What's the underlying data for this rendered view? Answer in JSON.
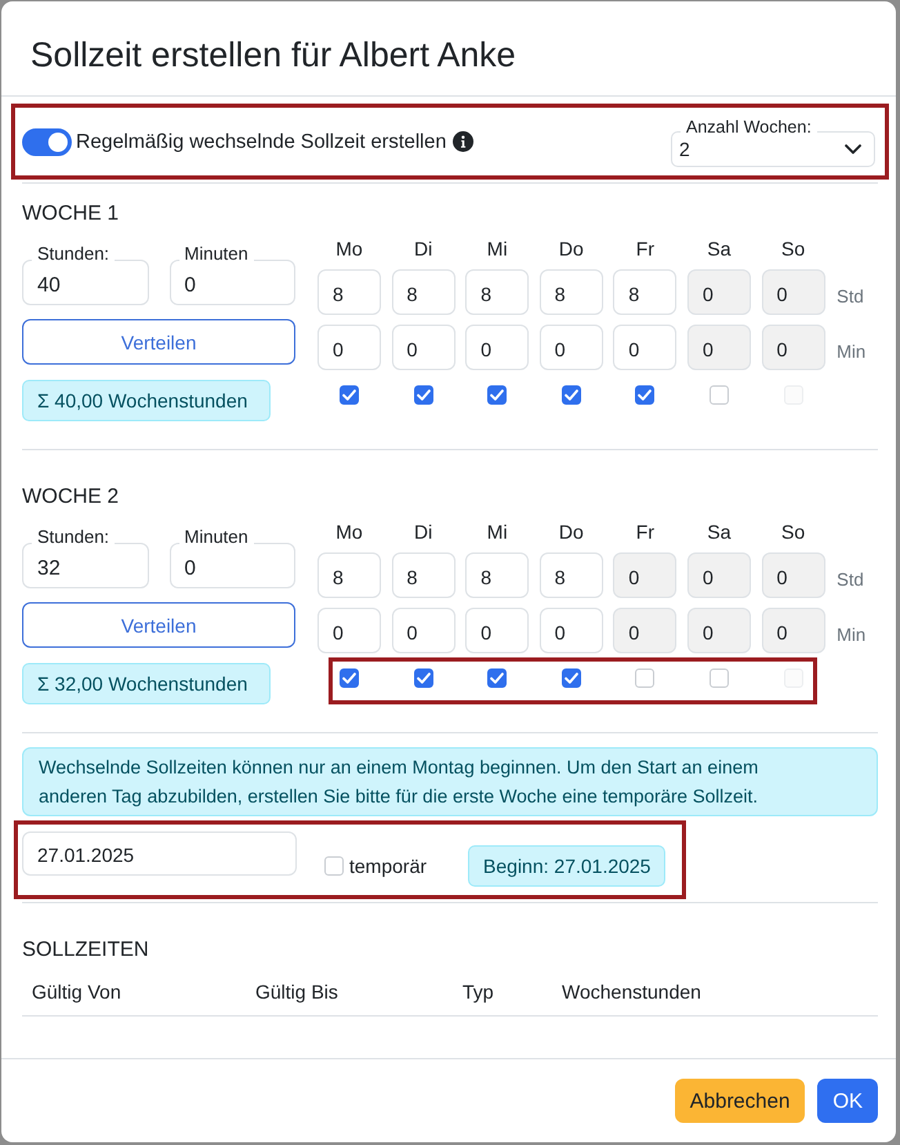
{
  "dialog": {
    "title": "Sollzeit erstellen für Albert Anke"
  },
  "options": {
    "highlighted": true,
    "toggle": {
      "label": "Regelmäßig wechselnde Sollzeit erstellen",
      "on": true
    },
    "weeks_count": {
      "label": "Anzahl Wochen:",
      "value": "2"
    }
  },
  "weeks": [
    {
      "title": "WOCHE 1",
      "hours": {
        "label": "Stunden:",
        "value": "40"
      },
      "minutes": {
        "label": "Minuten",
        "value": "0"
      },
      "distribute_button": "Verteilen",
      "total": "Σ 40,00 Wochenstunden",
      "hours_unit": "Std",
      "minutes_unit": "Min",
      "checkboxes_highlighted": false,
      "days": [
        {
          "label": "Mo",
          "hours": "8",
          "minutes": "0",
          "checked": true,
          "checkbox_disabled": false
        },
        {
          "label": "Di",
          "hours": "8",
          "minutes": "0",
          "checked": true,
          "checkbox_disabled": false
        },
        {
          "label": "Mi",
          "hours": "8",
          "minutes": "0",
          "checked": true,
          "checkbox_disabled": false
        },
        {
          "label": "Do",
          "hours": "8",
          "minutes": "0",
          "checked": true,
          "checkbox_disabled": false
        },
        {
          "label": "Fr",
          "hours": "8",
          "minutes": "0",
          "checked": true,
          "checkbox_disabled": false
        },
        {
          "label": "Sa",
          "hours": "0",
          "minutes": "0",
          "checked": false,
          "checkbox_disabled": false
        },
        {
          "label": "So",
          "hours": "0",
          "minutes": "0",
          "checked": false,
          "checkbox_disabled": true
        }
      ]
    },
    {
      "title": "WOCHE 2",
      "hours": {
        "label": "Stunden:",
        "value": "32"
      },
      "minutes": {
        "label": "Minuten",
        "value": "0"
      },
      "distribute_button": "Verteilen",
      "total": "Σ 32,00 Wochenstunden",
      "hours_unit": "Std",
      "minutes_unit": "Min",
      "checkboxes_highlighted": true,
      "days": [
        {
          "label": "Mo",
          "hours": "8",
          "minutes": "0",
          "checked": true,
          "checkbox_disabled": false
        },
        {
          "label": "Di",
          "hours": "8",
          "minutes": "0",
          "checked": true,
          "checkbox_disabled": false
        },
        {
          "label": "Mi",
          "hours": "8",
          "minutes": "0",
          "checked": true,
          "checkbox_disabled": false
        },
        {
          "label": "Do",
          "hours": "8",
          "minutes": "0",
          "checked": true,
          "checkbox_disabled": false
        },
        {
          "label": "Fr",
          "hours": "0",
          "minutes": "0",
          "checked": false,
          "checkbox_disabled": false
        },
        {
          "label": "Sa",
          "hours": "0",
          "minutes": "0",
          "checked": false,
          "checkbox_disabled": false
        },
        {
          "label": "So",
          "hours": "0",
          "minutes": "0",
          "checked": false,
          "checkbox_disabled": true
        }
      ]
    }
  ],
  "notice": "Wechselnde Sollzeiten können nur an einem Montag beginnen. Um den Start an einem anderen Tag abzubilden, erstellen Sie bitte für die erste Woche eine temporäre Sollzeit.",
  "start": {
    "highlighted": true,
    "date": "27.01.2025",
    "temporary": {
      "label": "temporär",
      "checked": false
    },
    "begin": "Beginn: 27.01.2025"
  },
  "targets": {
    "title": "SOLLZEITEN",
    "columns": [
      "Gültig Von",
      "Gültig Bis",
      "Typ",
      "Wochenstunden"
    ]
  },
  "buttons": [
    {
      "label": "Abbrechen",
      "kind": "cancel"
    },
    {
      "label": "OK",
      "kind": "primary"
    }
  ]
}
